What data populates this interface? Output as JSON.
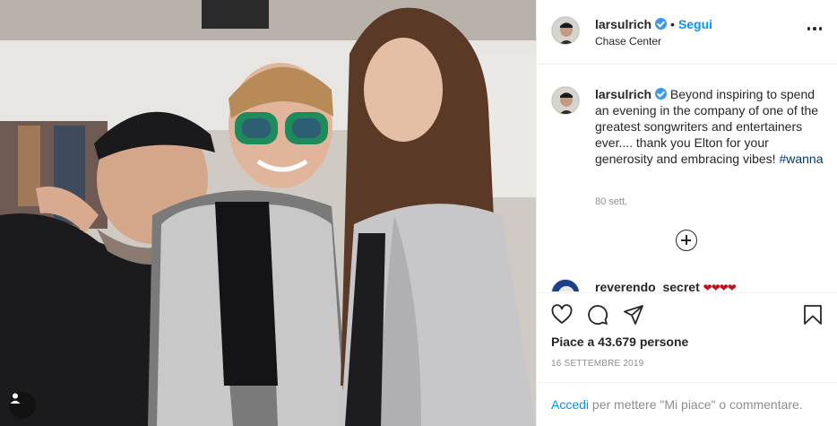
{
  "post": {
    "author": {
      "username": "larsulrich",
      "verified": true,
      "location": "Chase Center",
      "follow_label": "Segui",
      "separator": "•"
    },
    "caption": {
      "username": "larsulrich",
      "text": "Beyond inspiring to spend an evening in the company of one of the greatest songwriters and entertainers ever.... thank you Elton for your generosity and embracing vibes!",
      "hashtag": "#wanna",
      "age": "80 sett."
    },
    "comments": [
      {
        "username": "reverendo_secret",
        "text": "❤❤❤❤"
      }
    ],
    "actions": {
      "like_icon": "heart-icon",
      "comment_icon": "comment-icon",
      "share_icon": "paper-plane-icon",
      "save_icon": "bookmark-icon",
      "more_icon": "more-dots-icon",
      "load_more_icon": "plus-circle-icon"
    },
    "likes_text": "Piace a 43.679 persone",
    "date": "16 SETTEMBRE 2019",
    "login_prompt": {
      "link": "Accedi",
      "rest": " per mettere \"Mi piace\" o commentare."
    }
  },
  "colors": {
    "accent": "#0095f6",
    "verified": "#3897f0",
    "text": "#262626",
    "muted": "#8e8e8e",
    "border": "#efefef",
    "hearts": "#c0121d"
  }
}
